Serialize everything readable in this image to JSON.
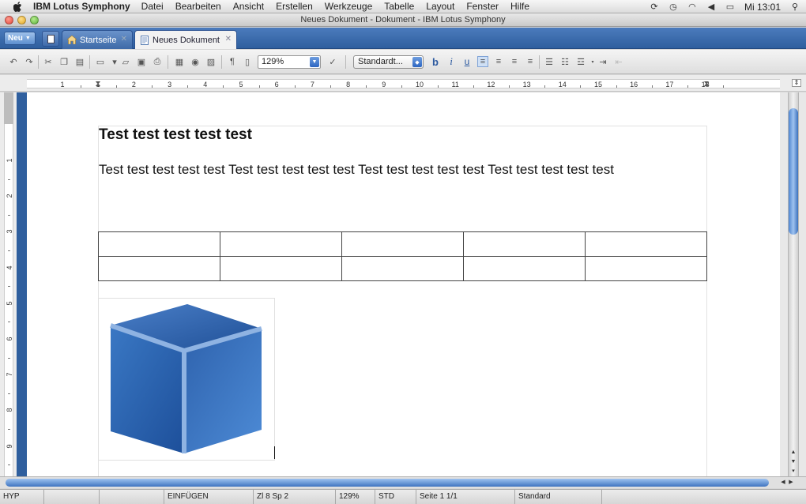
{
  "menubar": {
    "app_name": "IBM Lotus Symphony",
    "items": [
      "Datei",
      "Bearbeiten",
      "Ansicht",
      "Erstellen",
      "Werkzeuge",
      "Tabelle",
      "Layout",
      "Fenster",
      "Hilfe"
    ],
    "clock": "Mi 13:01"
  },
  "window": {
    "title": "Neues Dokument - Dokument - IBM Lotus Symphony"
  },
  "tabbar": {
    "new_label": "Neu",
    "tabs": [
      {
        "label": "Startseite",
        "icon": "home-icon"
      },
      {
        "label": "Neues Dokument",
        "icon": "document-icon"
      }
    ],
    "accent": "#3a6aad"
  },
  "toolbar": {
    "zoom": "129%",
    "paragraph_style": "Standardt..."
  },
  "ruler": {
    "horizontal_numbers": [
      "1",
      "1",
      "2",
      "3",
      "4",
      "5",
      "6",
      "7",
      "8",
      "9",
      "10",
      "11",
      "12",
      "13",
      "14",
      "15",
      "16",
      "17",
      "18"
    ],
    "vertical_numbers": [
      "1",
      "2",
      "3",
      "4",
      "5",
      "6",
      "7",
      "8",
      "9"
    ]
  },
  "document": {
    "heading": "Test test test test test",
    "body": "Test test test test test Test test test test test Test test test test test Test test test test test",
    "table": {
      "rows": 2,
      "cols": 5
    },
    "image": "blue-cube"
  },
  "statusbar": {
    "cells": [
      "HYP",
      "",
      "",
      "EINFÜGEN",
      "Zl 8 Sp 2",
      "129%",
      "STD",
      "Seite 1 1/1",
      "Standard",
      ""
    ]
  }
}
